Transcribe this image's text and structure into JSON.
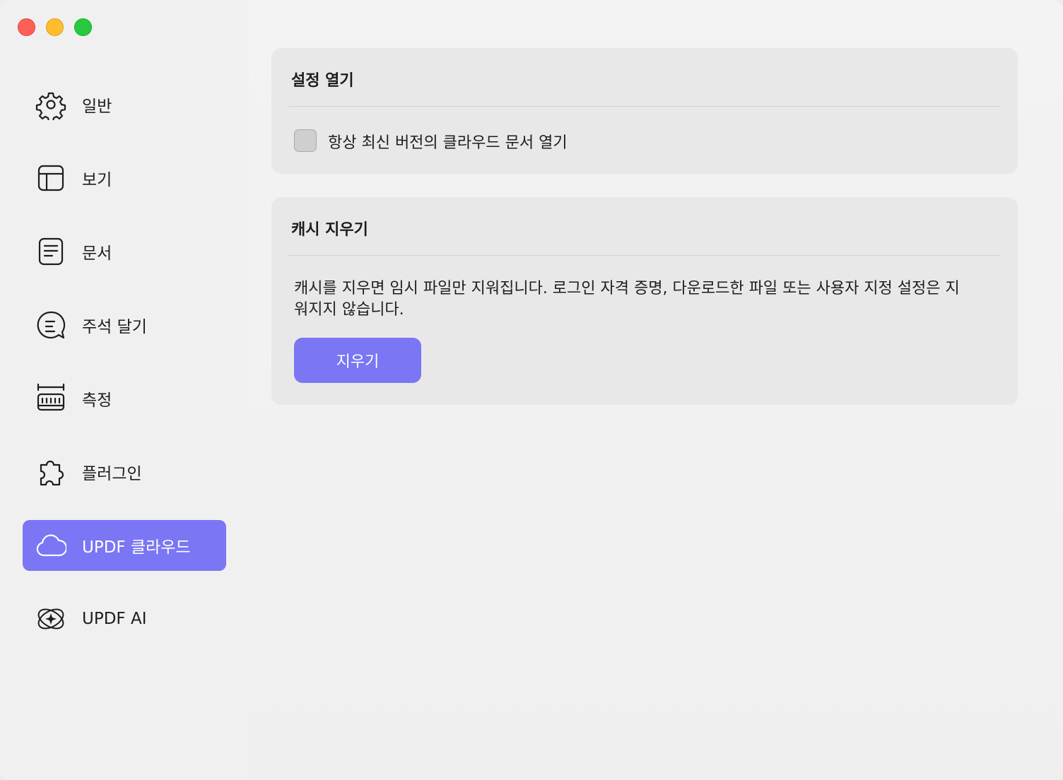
{
  "window": {
    "controls": [
      "close",
      "minimize",
      "zoom"
    ]
  },
  "sidebar": {
    "items": [
      {
        "label": "일반",
        "icon": "gear-icon",
        "active": false
      },
      {
        "label": "보기",
        "icon": "layout-icon",
        "active": false
      },
      {
        "label": "문서",
        "icon": "document-icon",
        "active": false
      },
      {
        "label": "주석 달기",
        "icon": "comment-icon",
        "active": false
      },
      {
        "label": "측정",
        "icon": "ruler-icon",
        "active": false
      },
      {
        "label": "플러그인",
        "icon": "puzzle-icon",
        "active": false
      },
      {
        "label": "UPDF 클라우드",
        "icon": "cloud-icon",
        "active": true
      },
      {
        "label": "UPDF AI",
        "icon": "ai-icon",
        "active": false
      }
    ]
  },
  "open_settings": {
    "title": "설정 열기",
    "checkbox_label": "항상 최신 버전의 클라우드 문서 열기",
    "checked": false
  },
  "clear_cache": {
    "title": "캐시 지우기",
    "description": "캐시를 지우면 임시 파일만 지워집니다. 로그인 자격 증명, 다운로드한 파일 또는 사용자 지정 설정은 지워지지 않습니다.",
    "button_label": "지우기"
  },
  "colors": {
    "accent": "#7a76f4",
    "card_bg": "#e8e8e8",
    "sidebar_bg": "#f0f0f0"
  }
}
